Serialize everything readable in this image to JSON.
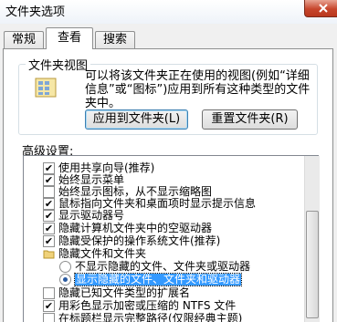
{
  "window": {
    "title": "文件夹选项"
  },
  "tabs": [
    {
      "label": "常规",
      "active": false
    },
    {
      "label": "查看",
      "active": true
    },
    {
      "label": "搜索",
      "active": false
    }
  ],
  "folder_views": {
    "title": "文件夹视图",
    "description": "可以将该文件夹正在使用的视图(例如“详细信息”或“图标”)应用到所有这种类型的文件夹中。",
    "apply_button": "应用到文件夹(L)",
    "reset_button": "重置文件夹(R)"
  },
  "advanced": {
    "label": "高级设置:",
    "items": [
      {
        "kind": "checkbox",
        "checked": true,
        "label": "使用共享向导(推荐)"
      },
      {
        "kind": "checkbox",
        "checked": true,
        "label": "始终显示菜单"
      },
      {
        "kind": "checkbox",
        "checked": false,
        "label": "始终显示图标，从不显示缩略图"
      },
      {
        "kind": "checkbox",
        "checked": true,
        "label": "鼠标指向文件夹和桌面项时显示提示信息"
      },
      {
        "kind": "checkbox",
        "checked": true,
        "label": "显示驱动器号"
      },
      {
        "kind": "checkbox",
        "checked": true,
        "label": "隐藏计算机文件夹中的空驱动器"
      },
      {
        "kind": "checkbox",
        "checked": true,
        "label": "隐藏受保护的操作系统文件(推荐)"
      },
      {
        "kind": "folder",
        "label": "隐藏文件和文件夹"
      },
      {
        "kind": "radio",
        "checked": false,
        "label": "不显示隐藏的文件、文件夹或驱动器"
      },
      {
        "kind": "radio",
        "checked": true,
        "label": "显示隐藏的文件、文件夹和驱动器"
      },
      {
        "kind": "checkbox",
        "checked": false,
        "label": "隐藏已知文件类型的扩展名"
      },
      {
        "kind": "checkbox",
        "checked": true,
        "label": "用彩色显示加密或压缩的 NTFS 文件"
      },
      {
        "kind": "checkbox",
        "checked": false,
        "label": "在标题栏显示完整路径(仅限经典主题)"
      }
    ]
  },
  "colors": {
    "selection": "#3399ff",
    "default_button_border": "#3c7fb1"
  }
}
